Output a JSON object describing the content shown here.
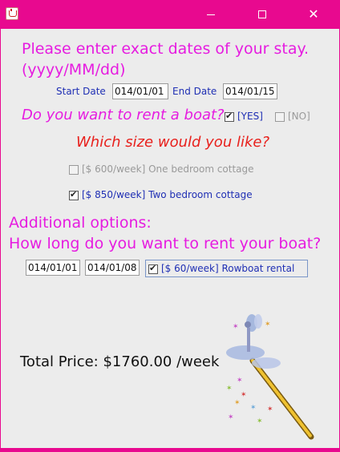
{
  "window": {
    "icon": "java-cup-icon"
  },
  "heading": {
    "line1": "Please enter exact dates of your stay.",
    "line2": "(yyyy/MM/dd)"
  },
  "stay": {
    "start_label": "Start Date",
    "start_value": "014/01/01",
    "end_label": "End Date",
    "end_value": "014/01/15"
  },
  "boat_question": {
    "text": "Do you want to rent a boat?",
    "yes_label": "[YES]",
    "yes_checked": true,
    "no_label": "[NO]",
    "no_checked": false
  },
  "size_question": "Which size would you like?",
  "cottages": [
    {
      "label": "[$ 600/week] One bedroom cottage",
      "checked": false,
      "enabled": false
    },
    {
      "label": "[$ 850/week] Two bedroom cottage",
      "checked": true,
      "enabled": true
    }
  ],
  "additional": {
    "line1": "Additional options:",
    "line2": "How long do you want to rent your boat?"
  },
  "boat_rental": {
    "start_value": "014/01/01",
    "end_value": "014/01/08",
    "option_label": "[$ 60/week] Rowboat rental",
    "checked": true
  },
  "total": "Total Price: $1760.00 /week",
  "colors": {
    "titlebar": "#e8098f",
    "heading": "#e61ce0",
    "question_red": "#e8201c",
    "label_blue": "#1f2fb4"
  },
  "decoration": "fairy-wand-image"
}
